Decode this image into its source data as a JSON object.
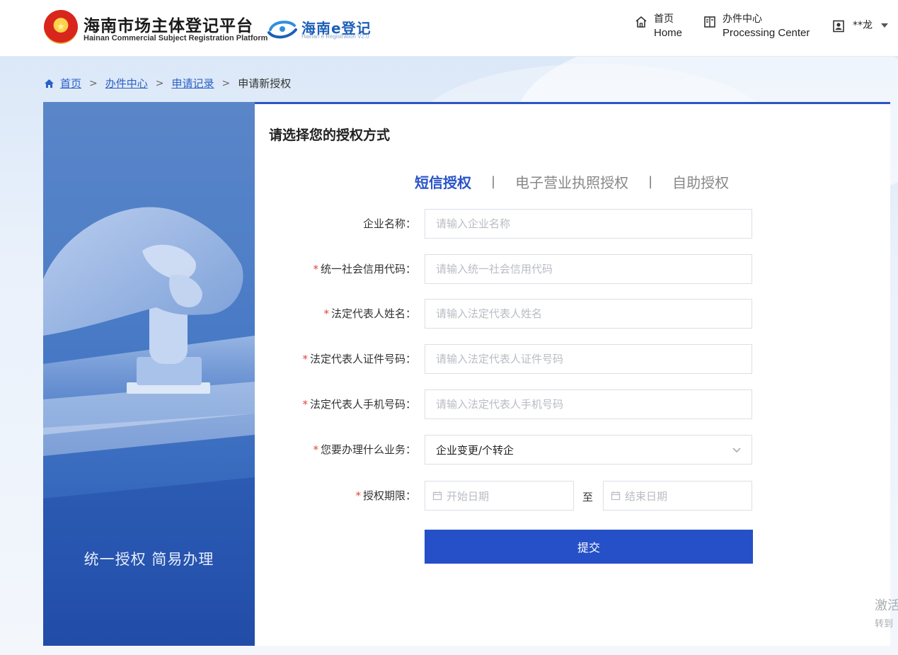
{
  "header": {
    "title": "海南市场主体登记平台",
    "subtitle": "Hainan Commercial Subject Registration Platform",
    "elogo_text": "海南e登记",
    "elogo_sub": "Hainan e Registration V2.0",
    "nav": [
      {
        "cn": "首页",
        "en": "Home",
        "icon": "home-icon"
      },
      {
        "cn": "办件中心",
        "en": "Processing Center",
        "icon": "document-icon"
      }
    ],
    "user": {
      "name": "**龙",
      "icon": "user-card-icon"
    }
  },
  "breadcrumb": {
    "items": [
      "首页",
      "办件中心",
      "申请记录"
    ],
    "current": "申请新授权"
  },
  "banner": {
    "slogan": "统一授权  简易办理"
  },
  "form": {
    "title": "请选择您的授权方式",
    "tabs": [
      {
        "label": "短信授权",
        "active": true
      },
      {
        "label": "电子营业执照授权",
        "active": false
      },
      {
        "label": "自助授权",
        "active": false
      }
    ],
    "fields": {
      "company_name": {
        "label": "企业名称：",
        "required": false,
        "placeholder": "请输入企业名称"
      },
      "credit_code": {
        "label": "统一社会信用代码：",
        "required": true,
        "placeholder": "请输入统一社会信用代码"
      },
      "rep_name": {
        "label": "法定代表人姓名：",
        "required": true,
        "placeholder": "请输入法定代表人姓名"
      },
      "rep_id": {
        "label": "法定代表人证件号码：",
        "required": true,
        "placeholder": "请输入法定代表人证件号码"
      },
      "rep_phone": {
        "label": "法定代表人手机号码：",
        "required": true,
        "placeholder": "请输入法定代表人手机号码"
      },
      "business": {
        "label": "您要办理什么业务：",
        "required": true,
        "value": "企业变更/个转企"
      },
      "period": {
        "label": "授权期限：",
        "required": true,
        "start_placeholder": "开始日期",
        "separator": "至",
        "end_placeholder": "结束日期"
      }
    },
    "required_mark": "*",
    "submit_label": "提交"
  },
  "watermark": {
    "line1": "激活",
    "line2": "转到"
  },
  "colors": {
    "accent": "#2b55c8",
    "submit": "#2550c7",
    "required": "#e0463a",
    "link": "#2a5fc7"
  }
}
